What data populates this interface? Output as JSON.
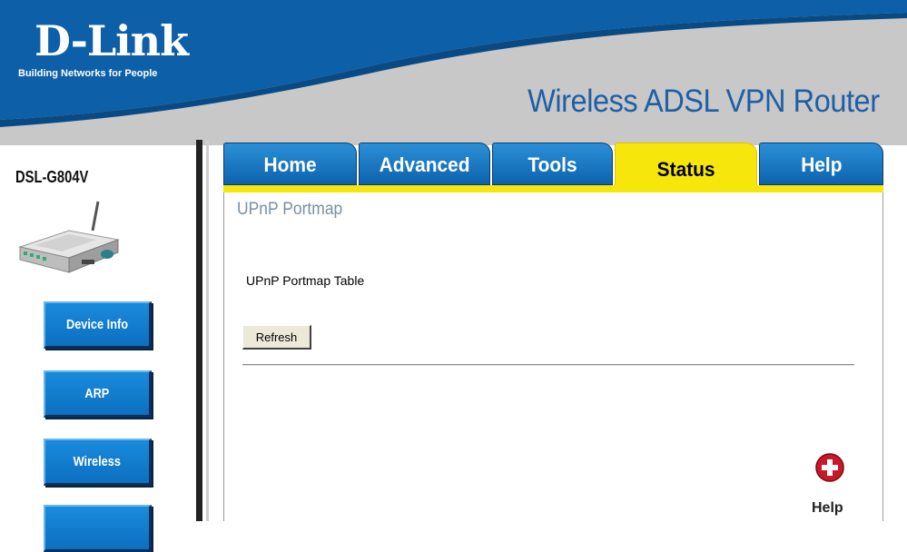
{
  "header": {
    "brand": "D-Link",
    "tagline": "Building Networks for People",
    "product_title": "Wireless ADSL VPN Router",
    "colors": {
      "brand_blue": "#0d5fa8",
      "header_gray": "#c8c8c8",
      "title_blue": "#1e5fa6"
    }
  },
  "sidebar": {
    "model": "DSL-G804V",
    "buttons": [
      {
        "label": "Device Info"
      },
      {
        "label": "ARP"
      },
      {
        "label": "Wireless"
      },
      {
        "label": ""
      }
    ]
  },
  "tabs": [
    {
      "label": "Home",
      "active": false
    },
    {
      "label": "Advanced",
      "active": false
    },
    {
      "label": "Tools",
      "active": false
    },
    {
      "label": "Status",
      "active": true
    },
    {
      "label": "Help",
      "active": false
    }
  ],
  "main": {
    "page_title": "UPnP Portmap",
    "table_title": "UPnP Portmap Table",
    "refresh_label": "Refresh",
    "help_label": "Help",
    "help_icon": "plus-help-icon"
  },
  "colors": {
    "active_tab": "#f6e60c",
    "tab_blue": "#0d63ad"
  }
}
